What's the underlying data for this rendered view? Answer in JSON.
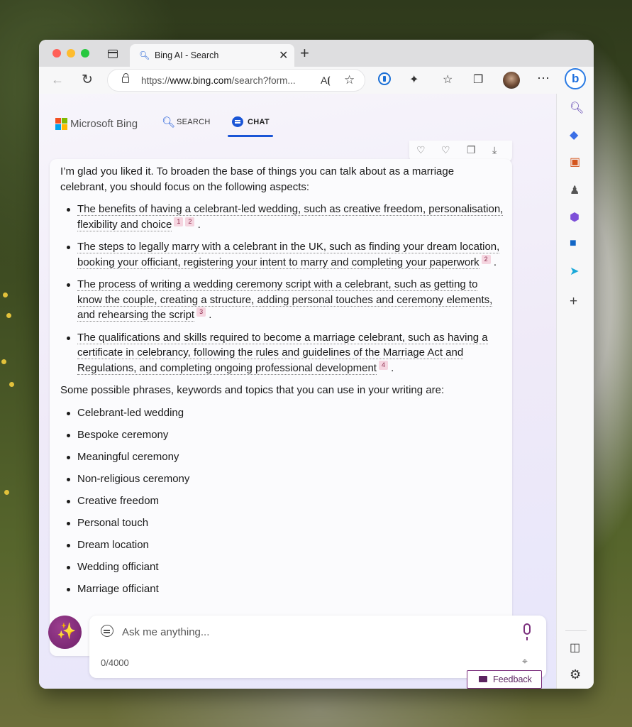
{
  "window": {
    "tab_title": "Bing AI - Search",
    "url_prefix": "https://",
    "url_host": "www.bing.com",
    "url_rest": "/search?form..."
  },
  "bing_nav": {
    "brand": "Microsoft Bing",
    "search_label": "SEARCH",
    "chat_label": "CHAT"
  },
  "message": {
    "intro": "I’m glad you liked it. To broaden the base of things you can talk about as a marriage celebrant, you should focus on the following aspects:",
    "aspects": [
      {
        "text": "The benefits of having a celebrant-led wedding, such as creative freedom, personalisation, flexibility and choice",
        "cites": [
          "1",
          "2"
        ]
      },
      {
        "text": "The steps to legally marry with a celebrant in the UK, such as finding your dream location, booking your officiant, registering your intent to marry and completing your paperwork",
        "cites": [
          "2"
        ]
      },
      {
        "text": "The process of writing a wedding ceremony script with a celebrant, such as getting to know the couple, creating a structure, adding personal touches and ceremony elements, and rehearsing the script",
        "cites": [
          "3"
        ]
      },
      {
        "text": "The qualifications and skills required to become a marriage celebrant, such as having a certificate in celebrancy, following the rules and guidelines of the Marriage Act and Regulations, and completing ongoing professional development",
        "cites": [
          "4"
        ]
      }
    ],
    "keywords_intro": "Some possible phrases, keywords and topics that you can use in your writing are:",
    "keywords": [
      "Celebrant-led wedding",
      "Bespoke ceremony",
      "Meaningful ceremony",
      "Non-religious ceremony",
      "Creative freedom",
      "Personal touch",
      "Dream location",
      "Wedding officiant",
      "Marriage officiant"
    ]
  },
  "input": {
    "placeholder": "Ask me anything...",
    "counter": "0/4000"
  },
  "feedback_label": "Feedback"
}
